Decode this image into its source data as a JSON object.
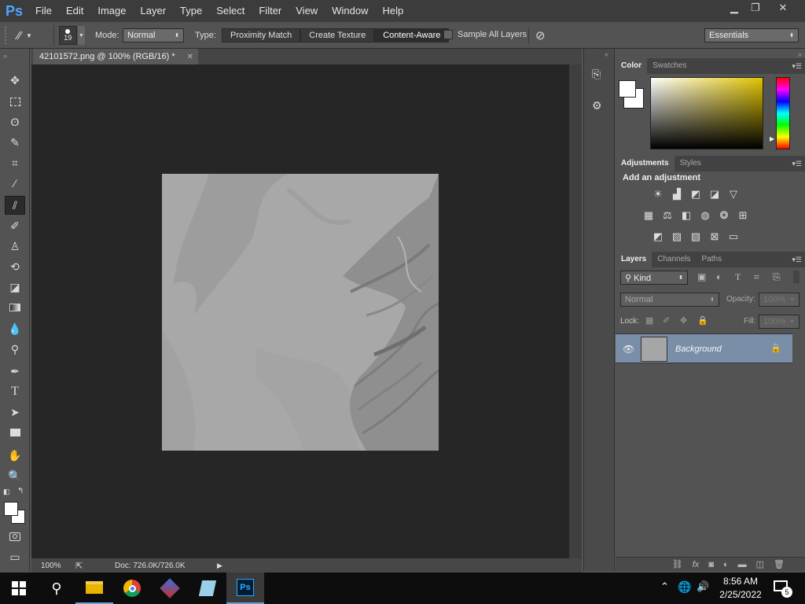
{
  "app": {
    "logo": "Ps"
  },
  "menu": [
    "File",
    "Edit",
    "Image",
    "Layer",
    "Type",
    "Select",
    "Filter",
    "View",
    "Window",
    "Help"
  ],
  "window_controls": {
    "minimize": "▁",
    "restore": "❐",
    "close": "✕"
  },
  "options": {
    "brush_size": "19",
    "mode_label": "Mode:",
    "mode_value": "Normal",
    "type_label": "Type:",
    "type_buttons": [
      "Proximity Match",
      "Create Texture",
      "Content-Aware"
    ],
    "type_active": "Content-Aware",
    "sample_all_layers": "Sample All Layers",
    "workspace": "Essentials"
  },
  "document": {
    "tab_title": "42101572.png @ 100% (RGB/16) *",
    "zoom": "100%",
    "doc_info": "Doc: 726.0K/726.0K"
  },
  "tools": [
    "move-tool",
    "marquee-tool",
    "lasso-tool",
    "quick-select-tool",
    "crop-tool",
    "eyedropper-tool",
    "spot-healing-tool",
    "brush-tool",
    "clone-stamp-tool",
    "history-brush-tool",
    "eraser-tool",
    "gradient-tool",
    "blur-tool",
    "dodge-tool",
    "pen-tool",
    "type-tool",
    "path-select-tool",
    "shape-tool",
    "hand-tool",
    "zoom-tool"
  ],
  "color_panel": {
    "tabs": [
      "Color",
      "Swatches"
    ],
    "active": "Color",
    "hue_color": "#e8d000"
  },
  "adjustments_panel": {
    "tabs": [
      "Adjustments",
      "Styles"
    ],
    "heading": "Add an adjustment"
  },
  "layers_panel": {
    "tabs": [
      "Layers",
      "Channels",
      "Paths"
    ],
    "filter_kind": "Kind",
    "blend_mode": "Normal",
    "opacity_label": "Opacity:",
    "opacity_value": "100%",
    "lock_label": "Lock:",
    "fill_label": "Fill:",
    "fill_value": "100%",
    "layers": [
      {
        "name": "Background",
        "visible": true,
        "locked": true
      }
    ]
  },
  "taskbar": {
    "time": "8:56 AM",
    "date": "2/25/2022",
    "notifications": "5"
  }
}
